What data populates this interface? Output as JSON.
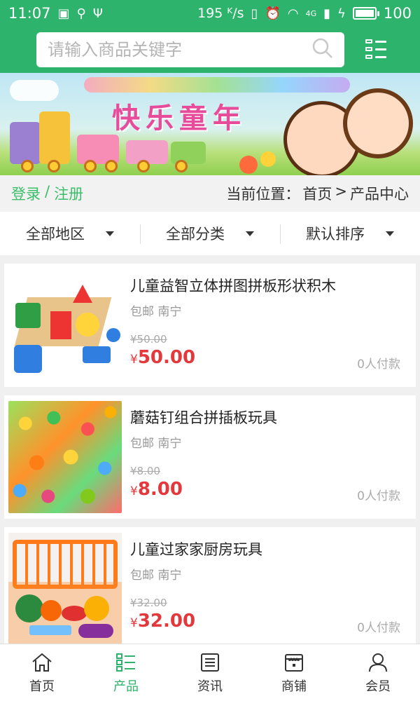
{
  "status": {
    "time": "11:07",
    "speed": "195 ᴷ/s",
    "network": "4G",
    "battery": "100",
    "battery_level": 1.0,
    "icons": [
      "image-icon",
      "usb-icon",
      "vibrate-icon",
      "alarm-icon",
      "wifi-icon",
      "signal-icon",
      "charging-icon",
      "battery-icon"
    ]
  },
  "header": {
    "search_placeholder": "请输入商品关键字",
    "search_icon": "search-icon",
    "menu_icon": "category-menu-icon"
  },
  "banner": {
    "title": "快乐童年"
  },
  "infobar": {
    "login": "登录",
    "separator": "/",
    "register": "注册",
    "breadcrumb_label": "当前位置：",
    "breadcrumb_home": "首页",
    "breadcrumb_sep": ">",
    "breadcrumb_current": "产品中心"
  },
  "filters": [
    {
      "label": "全部地区"
    },
    {
      "label": "全部分类"
    },
    {
      "label": "默认排序"
    }
  ],
  "products": [
    {
      "name": "儿童益智立体拼图拼板形状积木",
      "shipping": "包邮",
      "location": "南宁",
      "old_price": "¥50.00",
      "currency": "¥",
      "price": "50.00",
      "sold": "0人付款"
    },
    {
      "name": "蘑菇钉组合拼插板玩具",
      "shipping": "包邮",
      "location": "南宁",
      "old_price": "¥8.00",
      "currency": "¥",
      "price": "8.00",
      "sold": "0人付款"
    },
    {
      "name": "儿童过家家厨房玩具",
      "shipping": "包邮",
      "location": "南宁",
      "old_price": "¥32.00",
      "currency": "¥",
      "price": "32.00",
      "sold": "0人付款"
    }
  ],
  "tabs": [
    {
      "label": "首页",
      "icon": "home-icon",
      "active": false
    },
    {
      "label": "产品",
      "icon": "product-list-icon",
      "active": true
    },
    {
      "label": "资讯",
      "icon": "news-icon",
      "active": false
    },
    {
      "label": "商铺",
      "icon": "shop-icon",
      "active": false
    },
    {
      "label": "会员",
      "icon": "member-icon",
      "active": false
    }
  ],
  "colors": {
    "brand": "#2db36b",
    "price": "#e4393c",
    "link": "#3cbd6a"
  }
}
